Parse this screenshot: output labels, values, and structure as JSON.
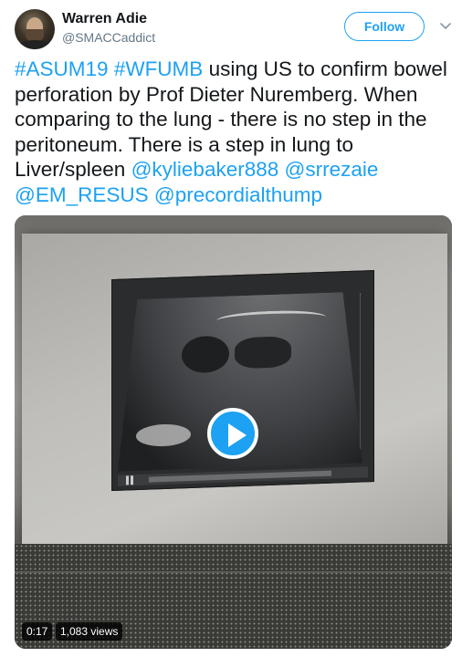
{
  "user": {
    "name": "Warren Adie",
    "handle": "@SMACCaddict"
  },
  "actions": {
    "follow_label": "Follow"
  },
  "tweet": {
    "segments": [
      {
        "text": "#ASUM19",
        "link": true
      },
      {
        "text": " ",
        "link": false
      },
      {
        "text": "#WFUMB",
        "link": true
      },
      {
        "text": " using US to confirm bowel perforation by Prof Dieter Nuremberg. When comparing to the lung - there is no step in the peritoneum. There is a step in lung to Liver/spleen ",
        "link": false
      },
      {
        "text": "@kyliebaker888",
        "link": true
      },
      {
        "text": " ",
        "link": false
      },
      {
        "text": "@srrezaie",
        "link": true
      },
      {
        "text": " ",
        "link": false
      },
      {
        "text": "@EM_RESUS",
        "link": true
      },
      {
        "text": " ",
        "link": false
      },
      {
        "text": "@precordialthump",
        "link": true
      }
    ]
  },
  "video": {
    "time": "0:17",
    "views": "1,083 views"
  },
  "colors": {
    "accent": "#1da1f2",
    "text": "#14171a",
    "secondary": "#657786"
  },
  "icons": {
    "caret": "chevron-down-icon",
    "play": "play-icon"
  }
}
